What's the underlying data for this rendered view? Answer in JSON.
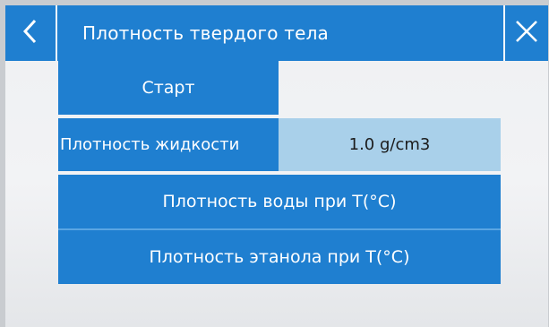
{
  "header": {
    "title": "Плотность твердого тела",
    "back_icon": "chevron-left-icon",
    "close_icon": "close-icon"
  },
  "menu": {
    "start_label": "Старт",
    "liquid_density_label": "Плотность жидкости",
    "liquid_density_value": "1.0 g/cm3",
    "water_density_label": "Плотность воды при T(°C)",
    "ethanol_density_label": "Плотность этанола при T(°C)"
  },
  "colors": {
    "accent": "#1f7fd0",
    "value_field": "#a9d0ea",
    "background": "#f0f1f3"
  }
}
